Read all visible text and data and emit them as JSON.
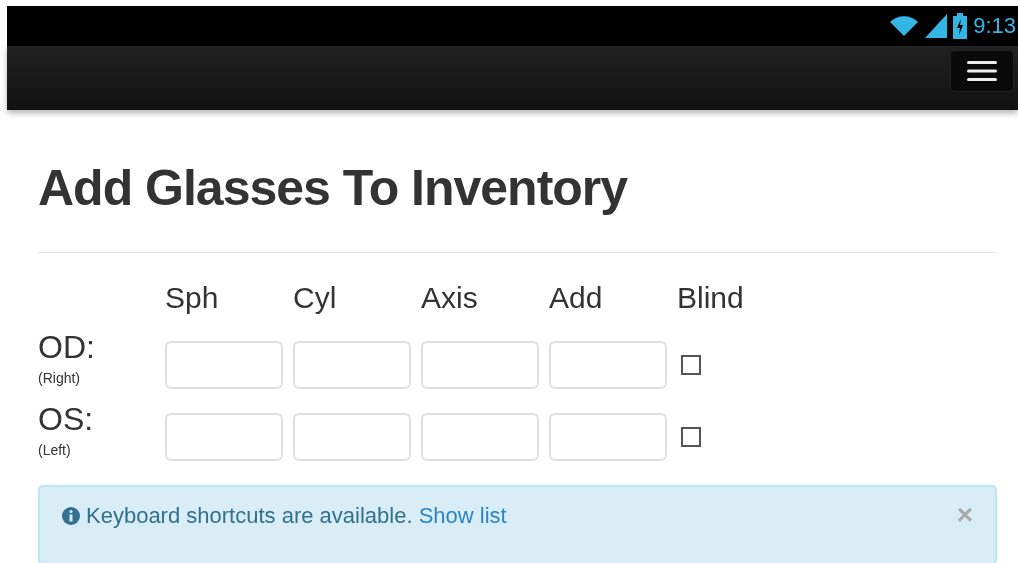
{
  "status_bar": {
    "time": "9:13"
  },
  "title": "Add Glasses To Inventory",
  "columns": [
    {
      "label": "Sph",
      "kind": "field"
    },
    {
      "label": "Cyl",
      "kind": "field"
    },
    {
      "label": "Axis",
      "kind": "field"
    },
    {
      "label": "Add",
      "kind": "field"
    },
    {
      "label": "Blind",
      "kind": "checkbox"
    }
  ],
  "rows": [
    {
      "label": "OD:",
      "sublabel": "(Right)",
      "checked": false
    },
    {
      "label": "OS:",
      "sublabel": "(Left)",
      "checked": false
    }
  ],
  "alert": {
    "text": "Keyboard shortcuts are available.",
    "link": "Show list",
    "close": "×"
  }
}
